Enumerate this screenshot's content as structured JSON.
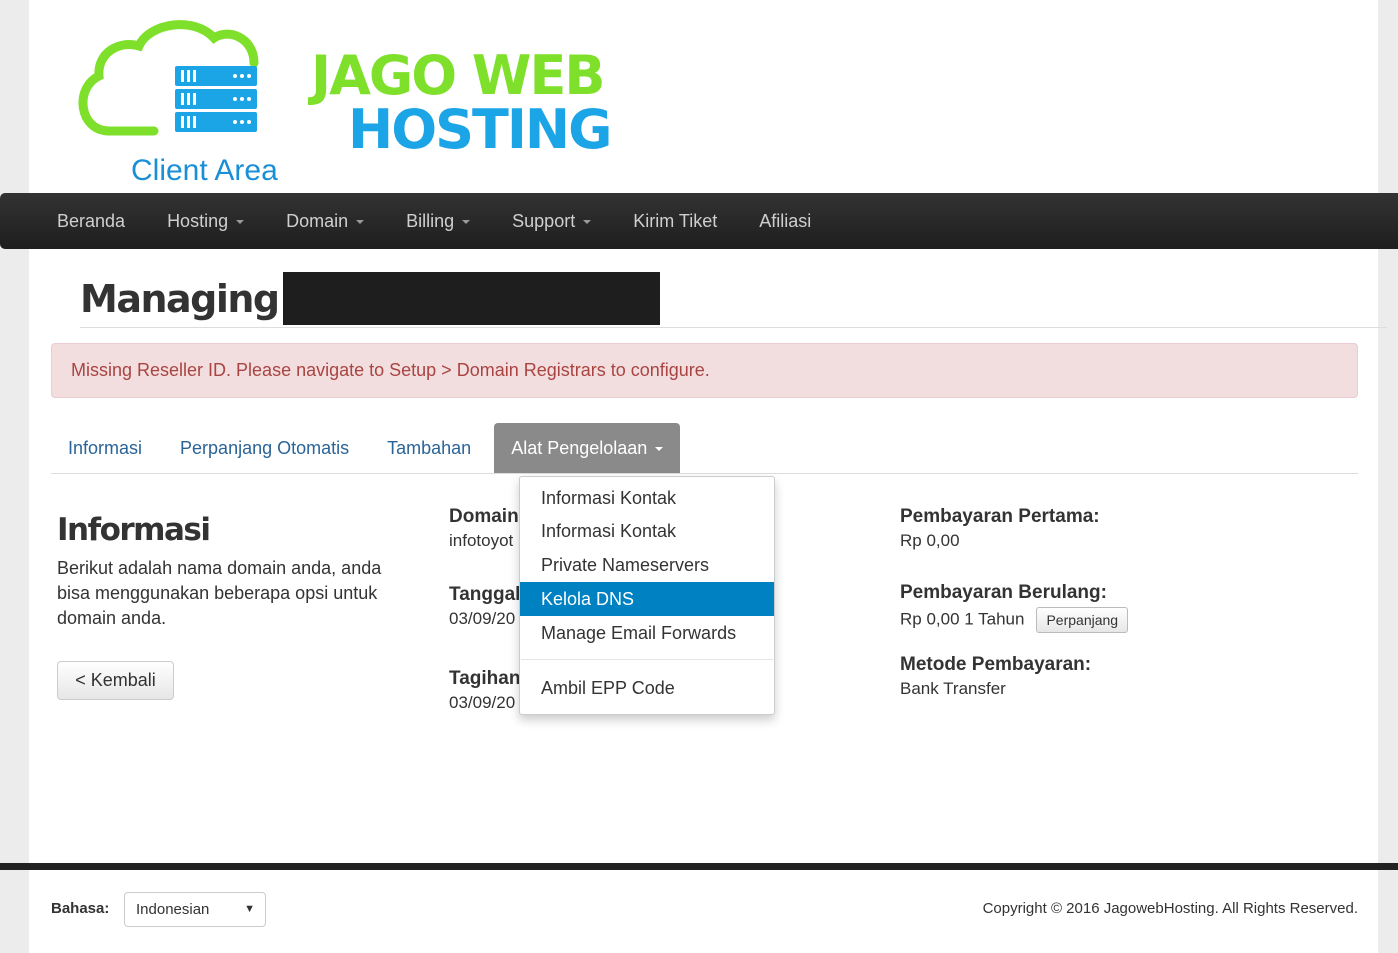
{
  "logo": {
    "brand_line1": "JAGO WEB",
    "brand_line2": "HOSTING",
    "subtitle": "Client Area",
    "cloud_color": "#7ee02a",
    "accent_color": "#1ca5e6"
  },
  "navbar": {
    "items": [
      {
        "label": "Beranda",
        "dropdown": false
      },
      {
        "label": "Hosting",
        "dropdown": true
      },
      {
        "label": "Domain",
        "dropdown": true
      },
      {
        "label": "Billing",
        "dropdown": true
      },
      {
        "label": "Support",
        "dropdown": true
      },
      {
        "label": "Kirim Tiket",
        "dropdown": false
      },
      {
        "label": "Afiliasi",
        "dropdown": false
      }
    ]
  },
  "page": {
    "title": "Managing"
  },
  "alert": {
    "message": "Missing Reseller ID. Please navigate to Setup > Domain Registrars to configure."
  },
  "tabs": {
    "items": [
      "Informasi",
      "Perpanjang Otomatis",
      "Tambahan"
    ],
    "active": "Alat Pengelolaan"
  },
  "dropdown": {
    "items": [
      "Informasi Kontak",
      "Informasi Kontak",
      "Private Nameservers",
      "Kelola DNS",
      "Manage Email Forwards"
    ],
    "selected": "Kelola DNS",
    "after_divider": "Ambil EPP Code"
  },
  "info": {
    "title": "Informasi",
    "description": "Berikut adalah nama domain anda, anda bisa menggunakan beberapa opsi untuk domain anda.",
    "back_button": "< Kembali"
  },
  "details": {
    "domain_label": "Domain",
    "domain_value": "infotoyot",
    "reg_date_label": "Tanggal",
    "reg_date_value": "03/09/20",
    "due_date_label": "Tagihan",
    "due_date_value": "03/09/20"
  },
  "payment": {
    "first_label": "Pembayaran Pertama:",
    "first_value": "Rp 0,00",
    "recurring_label": "Pembayaran Berulang:",
    "recurring_value": "Rp 0,00 1 Tahun",
    "renew_button": "Perpanjang",
    "method_label": "Metode Pembayaran:",
    "method_value": "Bank Transfer"
  },
  "footer": {
    "language_label": "Bahasa:",
    "language_value": "Indonesian",
    "copyright": "Copyright © 2016 JagowebHosting. All Rights Reserved."
  }
}
